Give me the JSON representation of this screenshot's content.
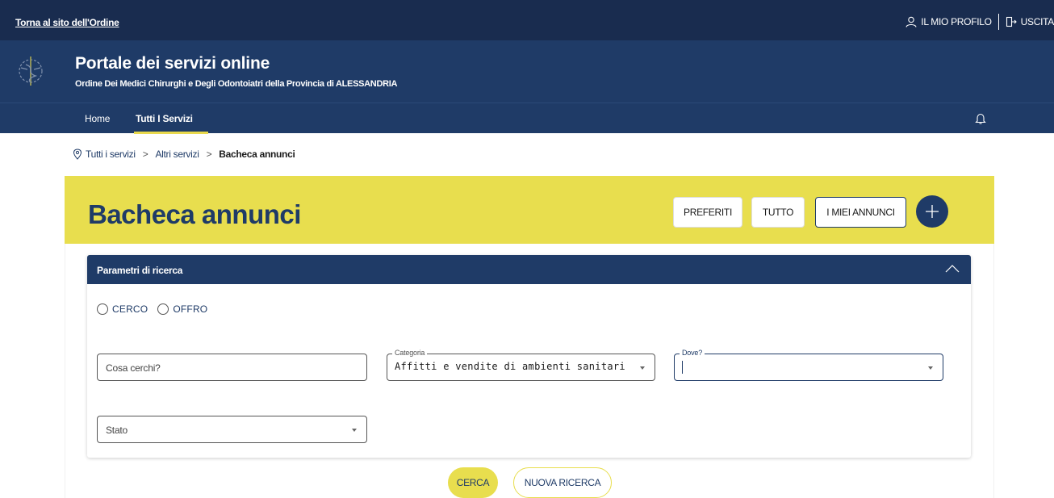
{
  "topbar": {
    "back_link": "Torna al sito dell'Ordine",
    "profile_label": "IL MIO PROFILO",
    "logout_label": "USCITA"
  },
  "header": {
    "title": "Portale dei servizi online",
    "subtitle": "Ordine Dei Medici Chirurghi e Degli Odontoiatri della Provincia di ALESSANDRIA"
  },
  "nav": {
    "items": [
      {
        "label": "Home",
        "active": false
      },
      {
        "label": "Tutti I Servizi",
        "active": true
      }
    ],
    "bell_icon": "bell-icon"
  },
  "breadcrumb": {
    "items": [
      "Tutti i servizi",
      "Altri servizi",
      "Bacheca annunci"
    ],
    "separator": ">"
  },
  "banner": {
    "heading": "Bacheca annunci",
    "buttons": {
      "preferiti": "PREFERITI",
      "tutto": "TUTTO",
      "miei": "I MIEI ANNUNCI"
    },
    "add_icon": "plus-icon"
  },
  "search": {
    "header_label": "Parametri di ricerca",
    "radios": [
      {
        "label": "CERCO",
        "checked": false
      },
      {
        "label": "OFFRO",
        "checked": false
      }
    ],
    "fields": {
      "cosa": {
        "placeholder": "Cosa cerchi?"
      },
      "categoria": {
        "legend": "Categoria",
        "value": "Affitti e vendite di ambienti sanitari"
      },
      "dove": {
        "legend": "Dove?",
        "value": ""
      },
      "stato": {
        "placeholder": "Stato"
      }
    },
    "cerca_label": "CERCA",
    "nuova_label": "NUOVA RICERCA"
  },
  "colors": {
    "navy": "#1f3b67",
    "topbar": "#192c4f",
    "yellow": "#e8de4e"
  }
}
